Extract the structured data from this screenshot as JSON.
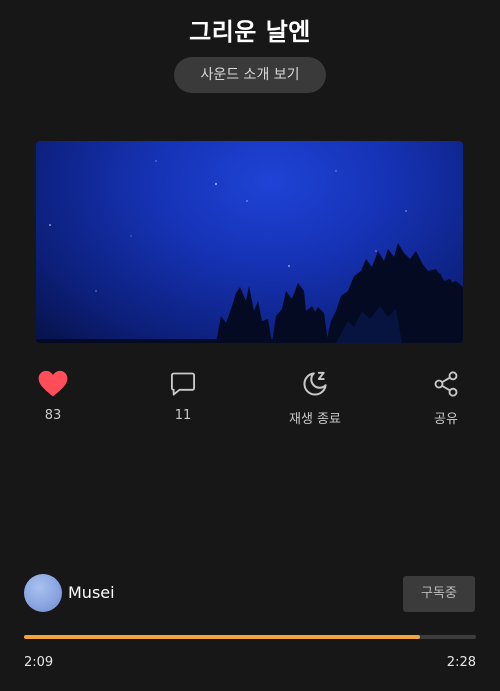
{
  "header": {
    "title": "그리운 날엔",
    "intro_button": "사운드 소개 보기"
  },
  "actions": {
    "like": {
      "icon": "heart-icon",
      "count": "83",
      "color": "#ff4d5a"
    },
    "comment": {
      "icon": "comment-icon",
      "count": "11"
    },
    "sleep_timer": {
      "icon": "moon-zz-icon",
      "label": "재생 종료"
    },
    "share": {
      "icon": "share-icon",
      "label": "공유"
    }
  },
  "creator": {
    "name": "Musei",
    "subscribe_label": "구독중"
  },
  "player": {
    "current_time": "2:09",
    "total_time": "2:28",
    "progress": 0.875,
    "accent_color": "#f3a43b"
  }
}
